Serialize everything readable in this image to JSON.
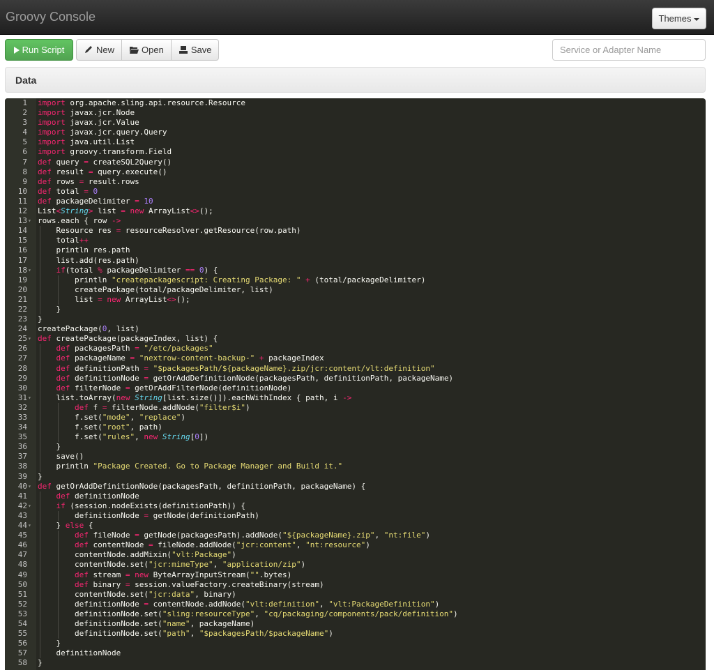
{
  "navbar": {
    "title": "Groovy Console",
    "themes_label": "Themes"
  },
  "toolbar": {
    "run_label": "Run Script",
    "new_label": "New",
    "open_label": "Open",
    "save_label": "Save",
    "service_placeholder": "Service or Adapter Name"
  },
  "panel": {
    "title": "Data"
  },
  "editor": {
    "lines": [
      "import org.apache.sling.api.resource.Resource",
      "import javax.jcr.Node",
      "import javax.jcr.Value",
      "import javax.jcr.query.Query",
      "import java.util.List",
      "import groovy.transform.Field",
      "def query = createSQL2Query()",
      "def result = query.execute()",
      "def rows = result.rows",
      "def total = 0",
      "def packageDelimiter = 10",
      "List<String> list = new ArrayList<>();",
      "rows.each { row ->",
      "    Resource res = resourceResolver.getResource(row.path)",
      "    total++",
      "    println res.path",
      "    list.add(res.path)",
      "    if(total % packageDelimiter == 0) {",
      "        println \"createpackagescript: Creating Package: \" + (total/packageDelimiter)",
      "        createPackage(total/packageDelimiter, list)",
      "        list = new ArrayList<>();",
      "    }",
      "}",
      "createPackage(0, list)",
      "def createPackage(packageIndex, list) {",
      "    def packagesPath = \"/etc/packages\"",
      "    def packageName = \"nextrow-content-backup-\" + packageIndex",
      "    def definitionPath = \"$packagesPath/${packageName}.zip/jcr:content/vlt:definition\"",
      "    def definitionNode = getOrAddDefinitionNode(packagesPath, definitionPath, packageName)",
      "    def filterNode = getOrAddFilterNode(definitionNode)",
      "    list.toArray(new String[list.size()]).eachWithIndex { path, i ->",
      "        def f = filterNode.addNode(\"filter$i\")",
      "        f.set(\"mode\", \"replace\")",
      "        f.set(\"root\", path)",
      "        f.set(\"rules\", new String[0])",
      "    }",
      "    save()",
      "    println \"Package Created. Go to Package Manager and Build it.\"",
      "}",
      "def getOrAddDefinitionNode(packagesPath, definitionPath, packageName) {",
      "    def definitionNode",
      "    if (session.nodeExists(definitionPath)) {",
      "        definitionNode = getNode(definitionPath)",
      "    } else {",
      "        def fileNode = getNode(packagesPath).addNode(\"${packageName}.zip\", \"nt:file\")",
      "        def contentNode = fileNode.addNode(\"jcr:content\", \"nt:resource\")",
      "        contentNode.addMixin(\"vlt:Package\")",
      "        contentNode.set(\"jcr:mimeType\", \"application/zip\")",
      "        def stream = new ByteArrayInputStream(\"\".bytes)",
      "        def binary = session.valueFactory.createBinary(stream)",
      "        contentNode.set(\"jcr:data\", binary)",
      "        definitionNode = contentNode.addNode(\"vlt:definition\", \"vlt:PackageDefinition\")",
      "        definitionNode.set(\"sling:resourceType\", \"cq/packaging/components/pack/definition\")",
      "        definitionNode.set(\"name\", packageName)",
      "        definitionNode.set(\"path\", \"$packagesPath/$packageName\")",
      "    }",
      "    definitionNode",
      "}"
    ],
    "fold_lines": [
      13,
      18,
      25,
      31,
      40,
      42,
      44
    ]
  },
  "colors": {
    "editor_bg": "#272822",
    "keyword": "#f92672",
    "string": "#e6db74",
    "number": "#ae81ff",
    "run_button": "#5cb85c"
  }
}
